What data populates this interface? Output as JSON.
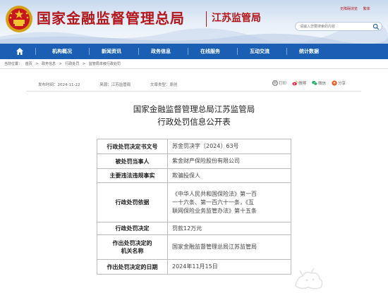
{
  "header": {
    "agency_name": "国家金融监督管理总局",
    "sub_name": "江苏监管局",
    "top_links": [
      "无障碍浏览",
      "繁体"
    ],
    "search_placeholder": "请输入您要搜索的内容"
  },
  "nav": {
    "items": [
      "机构概况",
      "新闻资讯",
      "政务信息",
      "在线服务",
      "互动交流",
      "统计数据"
    ]
  },
  "breadcrumb": [
    "当前位置：",
    "首页",
    ">",
    "政务信息",
    ">",
    "行政处罚",
    ">",
    "监管局本级行政处罚"
  ],
  "meta": {
    "publish_time": "发布时间：2024-11-22",
    "source": "来源：江苏监管局",
    "doc_type": "文章类型：原创"
  },
  "tools": {
    "print": "打印",
    "weibo": "微博",
    "wechat": "微信",
    "share": "分享"
  },
  "article": {
    "title_line1": "国家金融监督管理总局江苏监管局",
    "title_line2": "行政处罚信息公开表"
  },
  "table": {
    "rows": [
      {
        "key": "行政处罚决定书文号",
        "value": "苏金罚决字〔2024〕63号"
      },
      {
        "key": "被处罚当事人",
        "value": "紫金财产保险股份有限公司"
      },
      {
        "key": "主要违法违规事实",
        "value": "欺骗投保人"
      },
      {
        "key": "行政处罚依据",
        "value_lines": [
          "《中华人民共和国保险法》第一百",
          "一十六条、第一百六十一条，《互",
          "联网保险业务监管办法》第十五条"
        ]
      },
      {
        "key": "行政处罚决定",
        "value": "罚款12万元"
      },
      {
        "key_lines": [
          "作出处罚决定的",
          "机关名称"
        ],
        "value": "国家金融监督管理总局江苏监管局"
      },
      {
        "key": "作出处罚决定的日期",
        "value": "2024年11月15日"
      }
    ]
  },
  "colors": {
    "brand_red": "#b3161b",
    "nav_blue": "#1a5fb4"
  }
}
